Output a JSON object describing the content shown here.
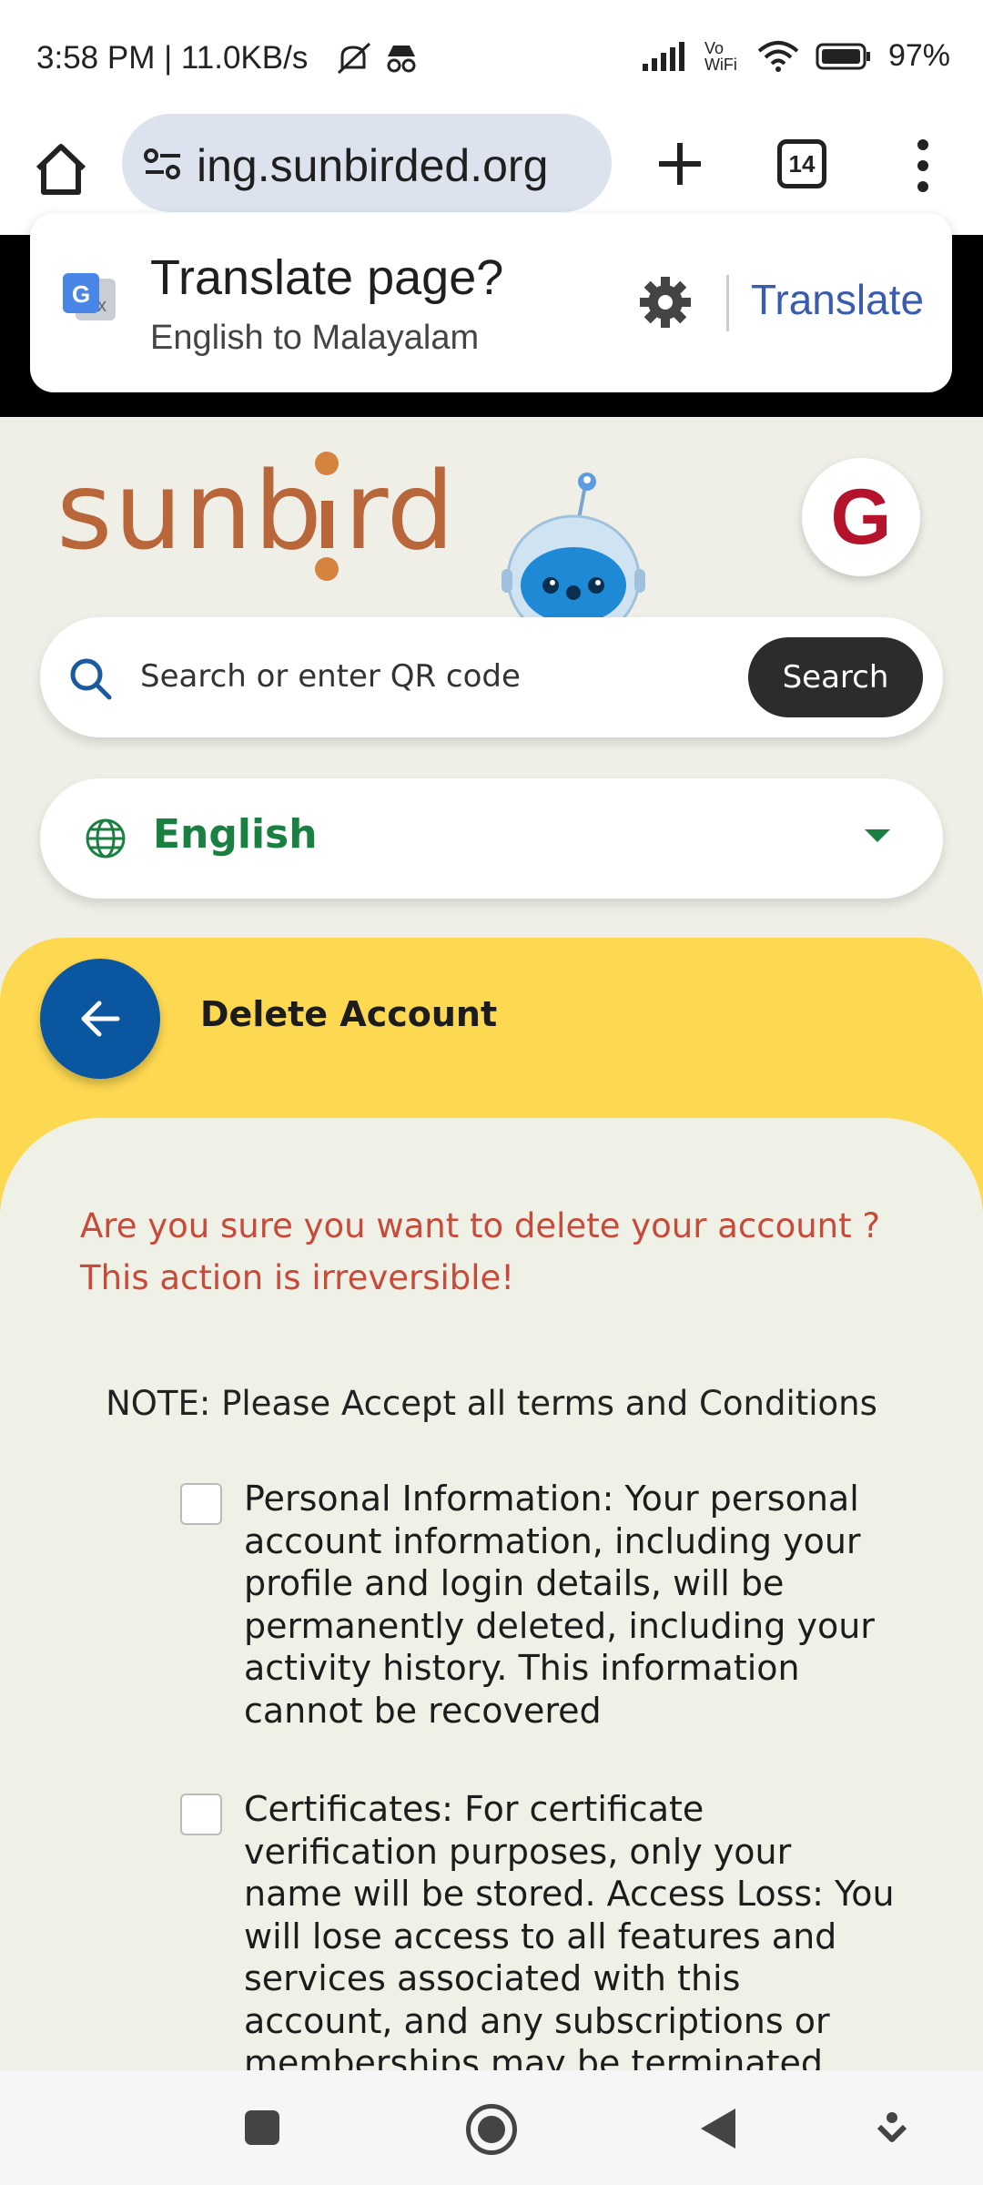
{
  "status_bar": {
    "time_speed": "3:58 PM | 11.0KB/s",
    "network": "Vo WiFi",
    "battery": "97%"
  },
  "browser": {
    "url": "ing.sunbirded.org",
    "tab_count": "14"
  },
  "translate_popup": {
    "title": "Translate page?",
    "subtitle": "English to Malayalam",
    "action": "Translate"
  },
  "header": {
    "avatar_letter": "G"
  },
  "search": {
    "placeholder": "Search or enter QR code",
    "button": "Search"
  },
  "language": {
    "selected": "English"
  },
  "page": {
    "title": "Delete Account",
    "warning": "Are you sure you want to delete your account ? This action is irreversible!",
    "note": "NOTE: Please Accept all terms and Conditions",
    "terms": [
      {
        "text": "Personal Information: Your personal account information, including your profile and login details, will be permanently deleted, including your activity history. This information cannot be recovered"
      },
      {
        "text": "Certificates: For certificate verification purposes, only your name will be stored. Access Loss: You will lose access to all features and services associated with this account, and any subscriptions or memberships may be terminated"
      }
    ]
  },
  "colors": {
    "brand_orange": "#b8663a",
    "accent_yellow": "#fdd851",
    "back_blue": "#0b56a0",
    "warning_red": "#c74a3a",
    "lang_green": "#198041"
  }
}
